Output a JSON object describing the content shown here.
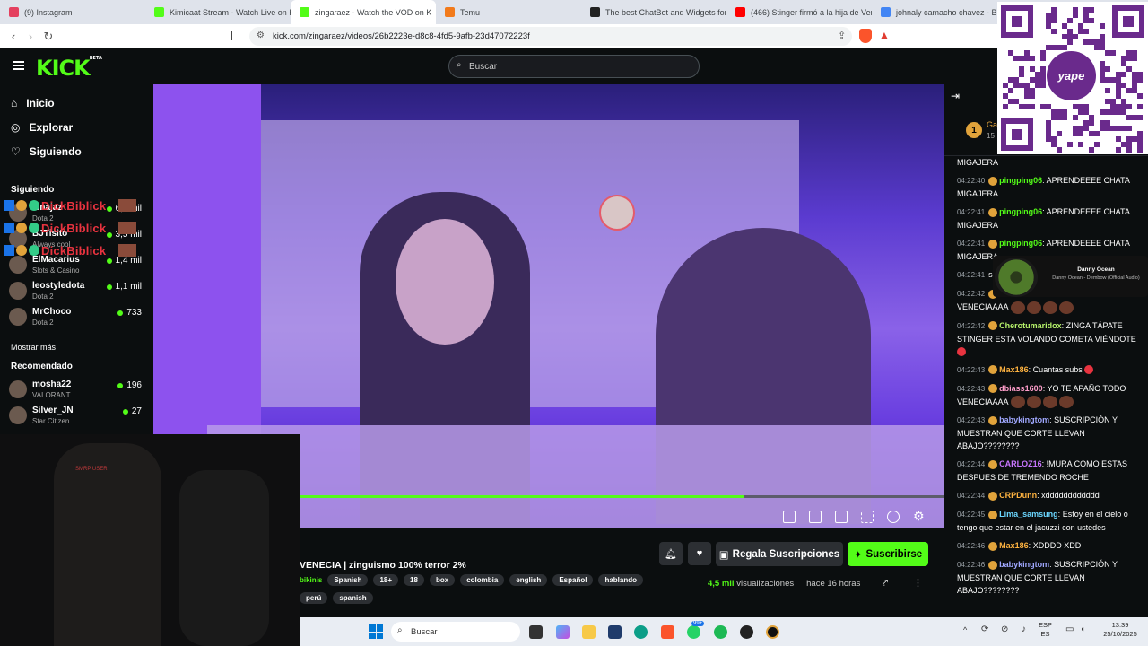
{
  "browser": {
    "tabs": [
      {
        "title": "(9) Instagram",
        "color": "#e4405f"
      },
      {
        "title": "Kimicaat Stream - Watch Live on Kick",
        "color": "#53fc18"
      },
      {
        "title": "zingaraez - Watch the VOD on K",
        "color": "#53fc18",
        "active": true
      },
      {
        "title": "Temu",
        "color": "#f27a1a"
      },
      {
        "title": "The best ChatBot and Widgets for K",
        "color": "#222222"
      },
      {
        "title": "(466) Stinger firmó a la hija de Vene",
        "color": "#ff0000"
      },
      {
        "title": "johnaly camacho chavez - Busc",
        "color": "#4285f4"
      }
    ],
    "url": "kick.com/zingaraez/videos/26b2223e-d8c8-4fd5-9afb-23d47072223f"
  },
  "site": {
    "logo": "KICK",
    "logo_tag": "BETA",
    "search_placeholder": "Buscar"
  },
  "sidebar": {
    "nav": [
      "Inicio",
      "Explorar",
      "Siguiendo"
    ],
    "following_title": "Siguiendo",
    "following": [
      {
        "name": "lenajaz",
        "game": "Dota 2",
        "viewers": "6,9 mil"
      },
      {
        "name": "BJTisito",
        "game": "Always cool",
        "viewers": "3,5 mil"
      },
      {
        "name": "ElMacarius",
        "game": "Slots & Casino",
        "viewers": "1,4 mil"
      },
      {
        "name": "leostyledota",
        "game": "Dota 2",
        "viewers": "1,1 mil"
      },
      {
        "name": "MrChoco",
        "game": "Dota 2",
        "viewers": "733"
      }
    ],
    "show_more": "Mostrar más",
    "recommended_title": "Recomendado",
    "recommended": [
      {
        "name": "mosha22",
        "game": "VALORANT",
        "viewers": "196"
      },
      {
        "name": "Silver_JN",
        "game": "Star Citizen",
        "viewers": "27"
      }
    ],
    "alert_text": "DickBiblick"
  },
  "video": {
    "progress": 0.69,
    "title": "VENECIA | zinguismo 100% terror 2%",
    "tags_row1": [
      "bikinis",
      "Spanish",
      "18+",
      "18",
      "box",
      "colombia",
      "english",
      "Español",
      "hablando"
    ],
    "tags_row2": [
      "perú",
      "spanish"
    ],
    "gift_label": "Regala Suscripciones",
    "subscribe_label": "Suscribirse",
    "views": "4,5 mil",
    "views_label": "visualizaciones",
    "ago": "hace 16 horas",
    "webcam_text": "SMRP USER"
  },
  "chat": {
    "header_user": "Ga",
    "header_count": "15",
    "messages": [
      {
        "ts": "",
        "user": "",
        "color": "#ffffff",
        "text": "MIGAJERA"
      },
      {
        "ts": "04:22:40",
        "user": "pingping06",
        "color": "#53fc18",
        "text": "APRENDEEEE CHATA MIGAJERA"
      },
      {
        "ts": "04:22:41",
        "user": "pingping06",
        "color": "#53fc18",
        "text": "APRENDEEEE CHATA MIGAJERA"
      },
      {
        "ts": "04:22:41",
        "user": "pingping06",
        "color": "#53fc18",
        "text": "APRENDEEEE CHATA MIGAJERA"
      },
      {
        "ts": "04:22:41",
        "user": "",
        "color": "#ffffff",
        "text": "subs"
      },
      {
        "ts": "04:22:42",
        "user": "dbiass1600",
        "color": "#ff9ecb",
        "text": "YO TE APAÑO TODO VENECIAAAA"
      },
      {
        "ts": "04:22:42",
        "user": "Cherotumaridox",
        "color": "#b7f36b",
        "text": "ZINGA TÁPATE STINGER ESTA VOLANDO COMETA VIÉNDOTE"
      },
      {
        "ts": "04:22:43",
        "user": "Max186",
        "color": "#ffb340",
        "text": "Cuantas subs"
      },
      {
        "ts": "04:22:43",
        "user": "dbiass1600",
        "color": "#ff9ecb",
        "text": "YO TE APAÑO TODO VENECIAAAA"
      },
      {
        "ts": "04:22:43",
        "user": "babykingtom",
        "color": "#a0a8ff",
        "text": "SUSCRIPCIÓN Y MUESTRAN QUE CORTE LLEVAN ABAJO????????"
      },
      {
        "ts": "04:22:44",
        "user": "CARLOZ16",
        "color": "#c875ff",
        "text": "!MURA COMO ESTAS DESPUES DE TREMENDO ROCHE"
      },
      {
        "ts": "04:22:44",
        "user": "CRPDunn",
        "color": "#ffb340",
        "text": "xdddddddddddd"
      },
      {
        "ts": "04:22:45",
        "user": "Lima_samsung",
        "color": "#6bd6ff",
        "text": "Estoy en el cielo o tengo que estar en el jacuzzi con ustedes"
      },
      {
        "ts": "04:22:46",
        "user": "Max186",
        "color": "#ffb340",
        "text": "XDDDD XDD"
      },
      {
        "ts": "04:22:46",
        "user": "babykingtom",
        "color": "#a0a8ff",
        "text": "SUSCRIPCIÓN Y MUESTRAN QUE CORTE LLEVAN ABAJO????????"
      }
    ]
  },
  "qr": {
    "brand": "yape"
  },
  "music": {
    "artist": "Danny Ocean",
    "track": "Danny Ocean - Dembow (Official Audio)"
  },
  "taskbar": {
    "search": "Buscar",
    "lang": "ESP",
    "region": "ES",
    "time": "13:39",
    "date": "25/10/2025",
    "badge": "99+"
  }
}
